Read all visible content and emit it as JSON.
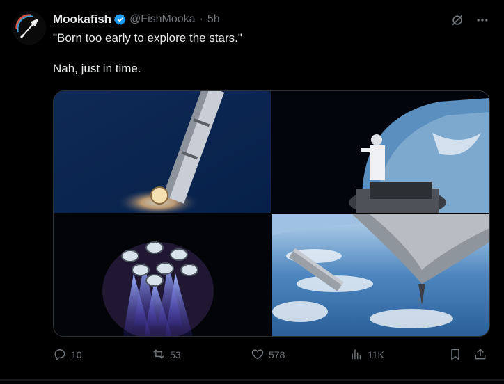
{
  "tweet": {
    "display_name": "Mookafish",
    "handle": "@FishMooka",
    "separator": "·",
    "time": "5h",
    "text_line1": "\"Born too early to explore the stars.\"",
    "text_line2": "Nah, just in time."
  },
  "media": [
    {
      "alt": "rocket-ascent"
    },
    {
      "alt": "astronaut-spacewalk"
    },
    {
      "alt": "engine-plumes"
    },
    {
      "alt": "ship-over-earth"
    }
  ],
  "actions": {
    "replies": "10",
    "reposts": "53",
    "likes": "578",
    "views": "11K"
  },
  "colors": {
    "background": "#000000",
    "text": "#e7e9ea",
    "muted": "#71767b",
    "verified": "#1d9bf0",
    "border": "#2f3336"
  },
  "icons": [
    "verified-badge-icon",
    "grok-icon",
    "more-icon",
    "reply-icon",
    "repost-icon",
    "like-icon",
    "views-icon",
    "bookmark-icon",
    "share-icon"
  ]
}
